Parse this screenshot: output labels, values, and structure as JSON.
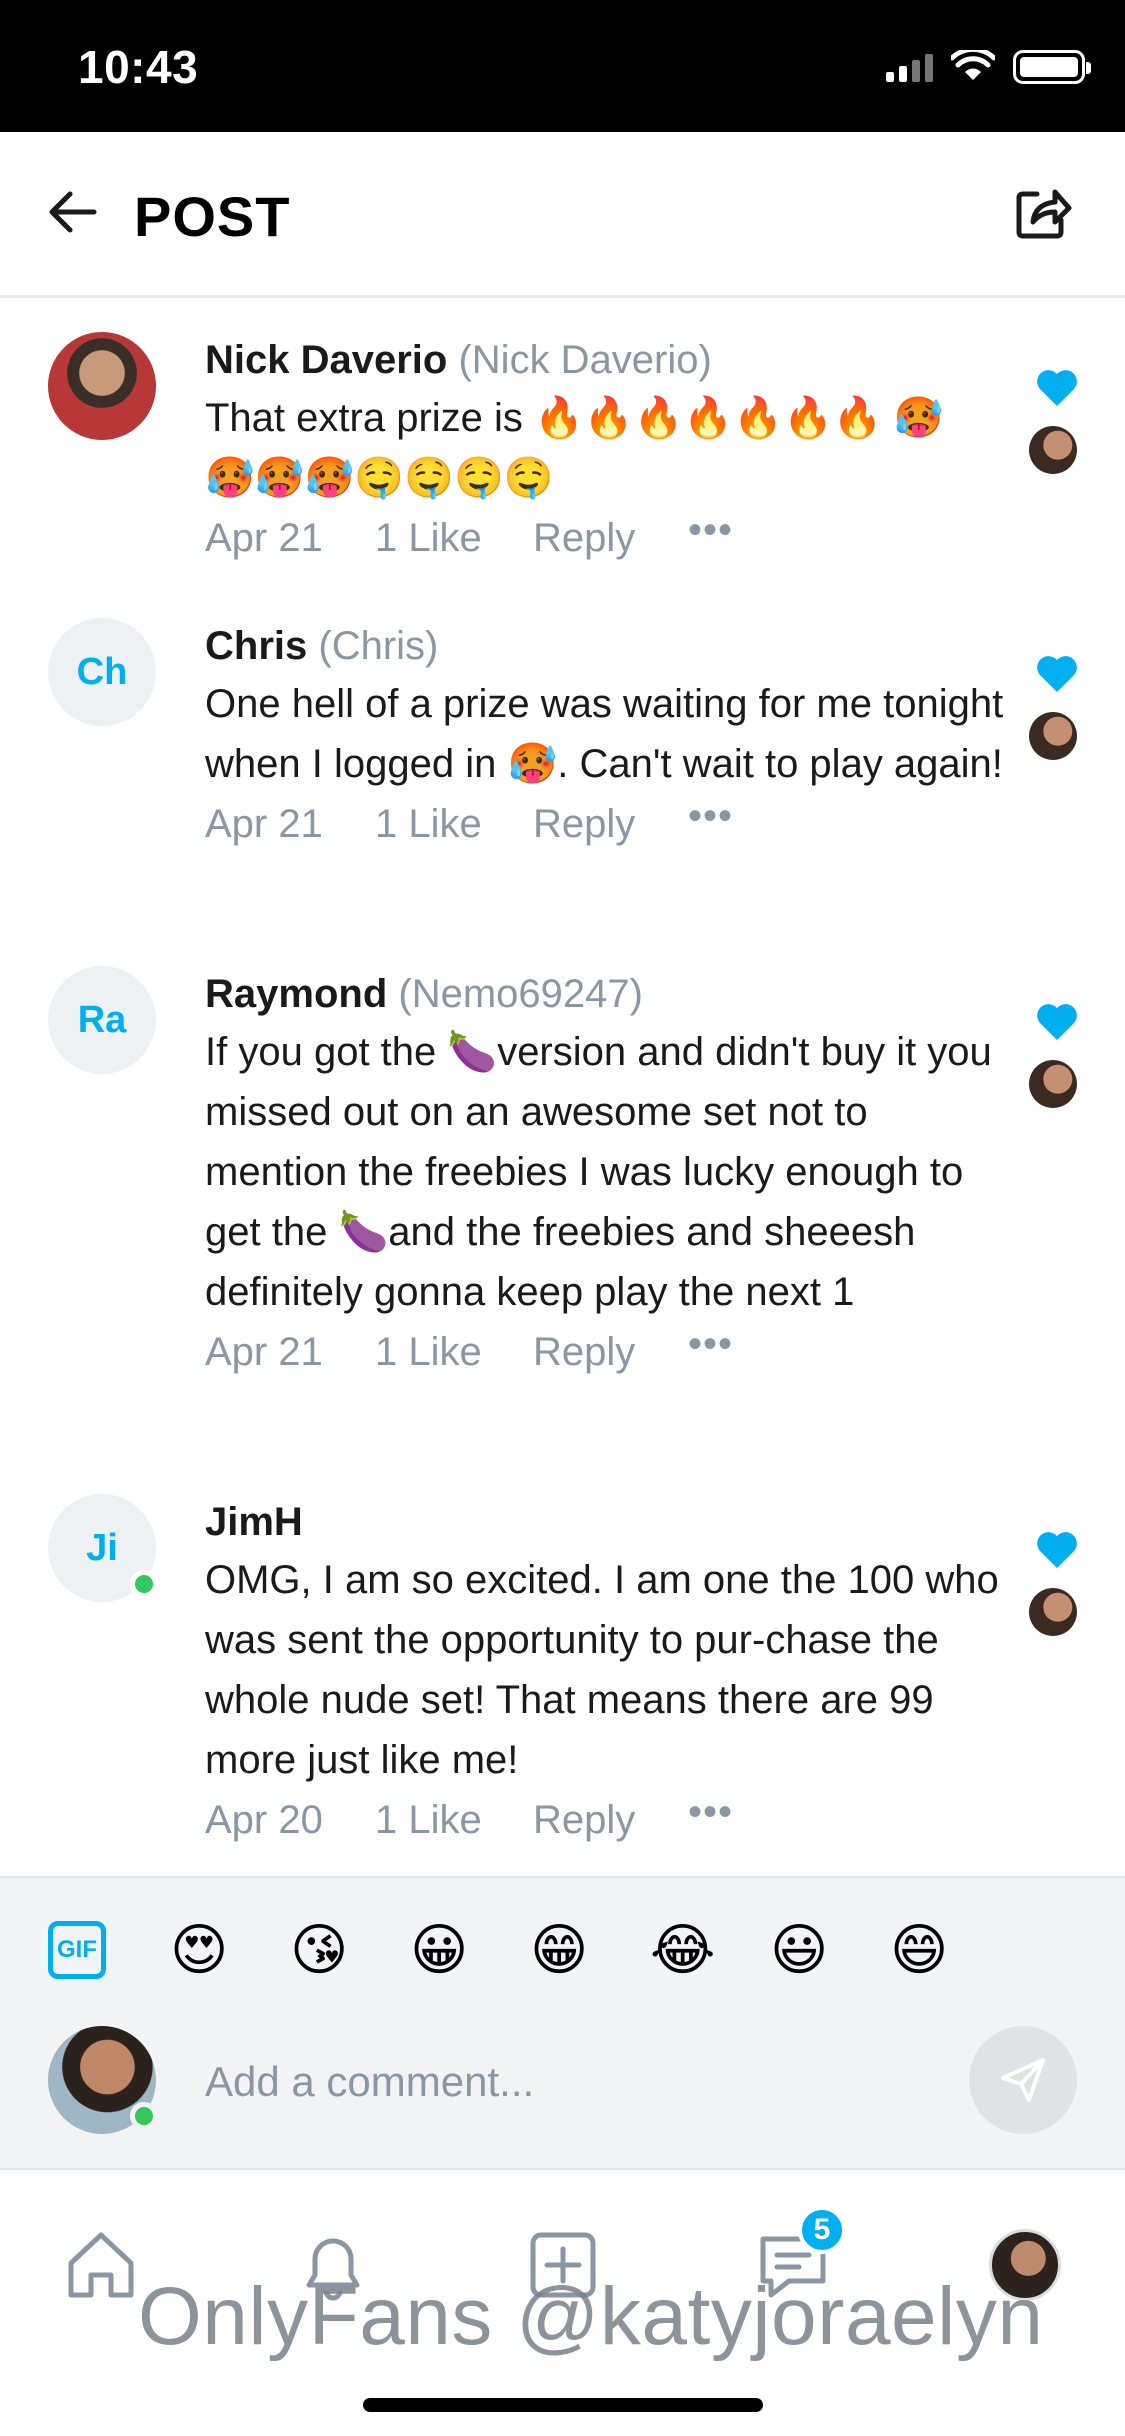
{
  "status_bar": {
    "time": "10:43"
  },
  "header": {
    "title": "POST"
  },
  "comments": [
    {
      "name": "Nick Daverio",
      "username": "(Nick Daverio)",
      "avatar_initials": "",
      "text": "That extra prize is 🔥🔥🔥🔥🔥🔥🔥 🥵🥵🥵🥵🤤🤤🤤🤤",
      "date": "Apr 21",
      "likes": "1 Like",
      "reply": "Reply",
      "more": "•••"
    },
    {
      "name": "Chris",
      "username": "(Chris)",
      "avatar_initials": "Ch",
      "text": "One hell of a prize was waiting for me tonight when I logged in 🥵. Can't wait to play again!",
      "date": "Apr 21",
      "likes": "1 Like",
      "reply": "Reply",
      "more": "•••"
    },
    {
      "name": "Raymond",
      "username": "(Nemo69247)",
      "avatar_initials": "Ra",
      "text": "If you got the 🍆version and didn't buy it you missed out on an awesome set not to mention the freebies I was lucky enough to get the 🍆and the freebies and sheeesh definitely gonna keep play the next 1",
      "date": "Apr 21",
      "likes": "1 Like",
      "reply": "Reply",
      "more": "•••"
    },
    {
      "name": "JimH",
      "username": "",
      "avatar_initials": "Ji",
      "text": "OMG, I am so excited. I am one the 100 who was sent the opportunity to pur-chase the whole nude set! That means there are 99 more just like me!",
      "date": "Apr 20",
      "likes": "1 Like",
      "reply": "Reply",
      "more": "•••"
    }
  ],
  "emoji_bar": {
    "gif_label": "GIF",
    "emojis": [
      "😍",
      "😘",
      "😀",
      "😁",
      "😂",
      "😃",
      "😄"
    ]
  },
  "comment_input": {
    "placeholder": "Add a comment..."
  },
  "bottom_nav": {
    "messages_badge": "5"
  },
  "watermark": "OnlyFans @katyjoraelyn",
  "colors": {
    "accent": "#00aff0",
    "muted": "#8a96a3",
    "online": "#34c759"
  }
}
